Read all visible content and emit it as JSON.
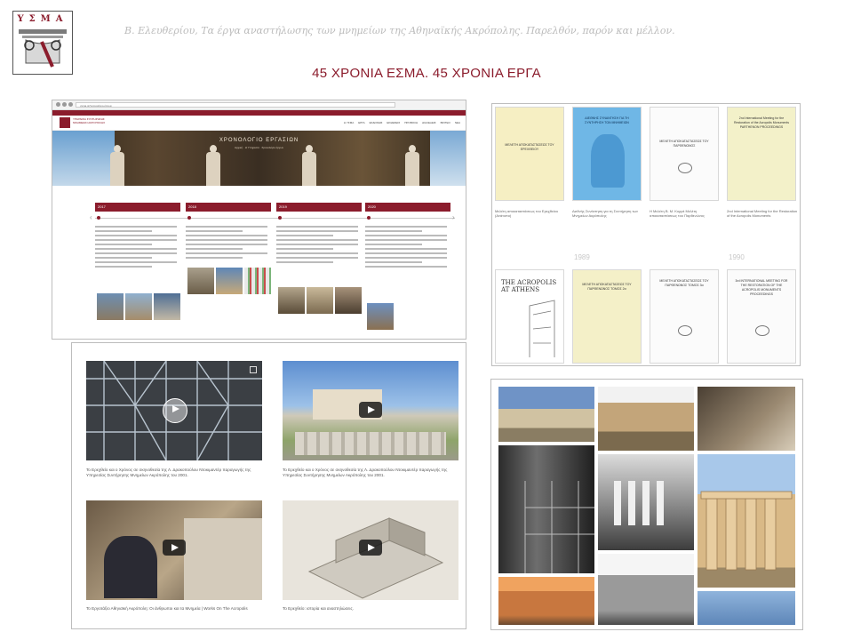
{
  "header": {
    "logo_text": "ΥΣΜΑ",
    "subtitle": "Β. Ελευθερίου, Τα έργα αναστήλωσης των μνημείων της Αθηναϊκής Ακρόπολης. Παρελθόν, παρόν και μέλλον.",
    "headline": "45 ΧΡΟΝΙΑ ΕΣΜΑ. 45 ΧΡΟΝΙΑ ΕΡΓΑ"
  },
  "browser": {
    "url": "ysma.gr/χρονολόγιο-έργων",
    "site_name": "ΥΠΗΡΕΣΙΑ ΣΥΝΤΗΡΗΣΗΣ ΜΝΗΜΕΙΩΝ ΑΚΡΟΠΟΛΗΣ",
    "nav": [
      "Η ΥΣΜΑ",
      "ΕΡΓΑ",
      "ΕΚΔΟΣΕΙΣ",
      "ΕΚΘΕΣΕΙΣ",
      "ΠΡΟΒΟΛΗ",
      "ΔΙΑΛΕΞΕΙΣ",
      "ΒΙΝΤΕΟ",
      "ΝΕΑ"
    ],
    "hero_title": "ΧΡΟΝΟΛΟΓΙΟ ΕΡΓΑΣΙΩΝ",
    "hero_crumb": "Αρχική · Η Υπηρεσία · Χρονολόγιο έργων",
    "years": [
      "2017",
      "2018",
      "2019",
      "2020"
    ]
  },
  "publications": {
    "books": [
      {
        "title": "ΜΕΛΕΤΗ ΑΠΟΚΑΤΑΣΤΑΣΕΩΣ ΤΟΥ ΕΡΕΧΘΕΙΟΥ",
        "caption": "Μελέτη αποκαταστάσεως του Ερεχθείου (Ανάτυπο)"
      },
      {
        "title": "ΔΙΕΘΝΗΣ ΣΥΝΑΝΤΗΣΗ ΓΙΑ ΤΗ ΣΥΝΤΗΡΗΣΗ ΤΩΝ ΜΝΗΜΕΙΩΝ",
        "caption": "Διεθνής Συνάντηση για τη Συντήρηση των Μνημείων Ακρόπολης"
      },
      {
        "title": "ΜΕΛΕΤΗ ΑΠΟΚΑΤΑΣΤΑΣΕΩΣ ΤΟΥ ΠΑΡΘΕΝΩΝΟΣ",
        "caption": "Η Μελέτη Β. Μ. Κορρέ Μελέτη αποκαταστάσεως του Παρθενώνος"
      },
      {
        "title": "2nd International Meeting for the Restoration of the Acropolis Monuments PARTHENON PROCEEDINGS",
        "caption": "2nd International Meeting for the Restoration of the Acropolis Monuments"
      },
      {
        "title": "THE ACROPOLIS AT ATHENS",
        "caption": ""
      },
      {
        "title": "ΜΕΛΕΤΗ ΑΠΟΚΑΤΑΣΤΑΣΕΩΣ ΤΟΥ ΠΑΡΘΕΝΩΝΟΣ ΤΟΜΟΣ 2α",
        "caption": ""
      },
      {
        "title": "ΜΕΛΕΤΗ ΑΠΟΚΑΤΑΣΤΑΣΕΩΣ ΤΟΥ ΠΑΡΘΕΝΩΝΟΣ ΤΟΜΟΣ 3α",
        "caption": ""
      },
      {
        "title": "3rd INTERNATIONAL MEETING FOR THE RESTORATION OF THE ACROPOLIS MONUMENTS PROCEEDINGS",
        "caption": ""
      }
    ],
    "years": [
      "1989",
      "1990"
    ]
  },
  "videos": [
    {
      "caption": "Το Ερεχθείο και ο Χρόνος σε σκηνοθεσία της Λ. Δρακοπούλου Ντοκιμαντέρ παραγωγής της Υπηρεσίας Συντήρησης Μνημείων Ακρόπολης του 2001."
    },
    {
      "caption": "Το Ερεχθείο και ο Χρόνος σε σκηνοθεσία της Λ. Δρακοπούλου Ντοκιμαντέρ παραγωγής της Υπηρεσίας Συντήρησης Μνημείων Ακρόπολης του 2001."
    },
    {
      "caption": "Το Εργοτάξιο Αθηναϊκή Ακρόπολη: Οι άνθρωποι και τα Μνημεία | Works On The Acropolis"
    },
    {
      "caption": "Το Ερεχθείο: ιστορία και αναστηλώσεις."
    }
  ]
}
